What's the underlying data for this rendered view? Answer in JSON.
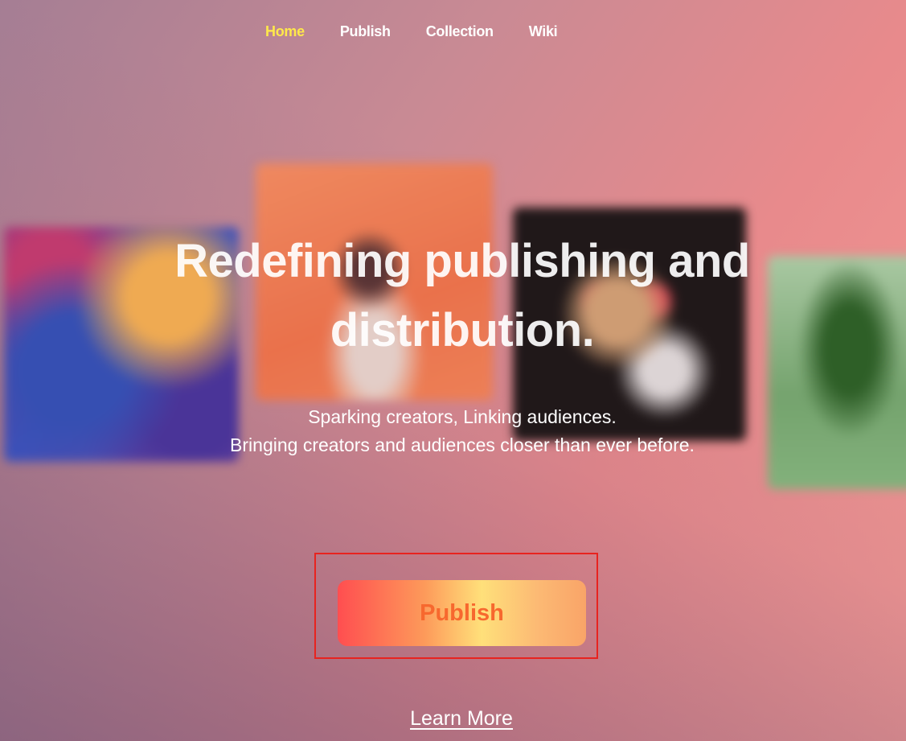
{
  "nav": {
    "items": [
      {
        "label": "Home",
        "active": true
      },
      {
        "label": "Publish",
        "active": false
      },
      {
        "label": "Collection",
        "active": false
      },
      {
        "label": "Wiki",
        "active": false
      }
    ],
    "active_color": "#ffe94a"
  },
  "hero": {
    "title_line1": "Redefining publishing and",
    "title_line2": "distribution.",
    "subtitle_line1": "Sparking creators, Linking audiences.",
    "subtitle_line2": "Bringing creators and audiences closer than ever before."
  },
  "cta": {
    "publish_label": "Publish",
    "learn_more_label": "Learn More"
  },
  "colors": {
    "highlight_border": "#e8231f",
    "button_text": "#f7682e"
  }
}
